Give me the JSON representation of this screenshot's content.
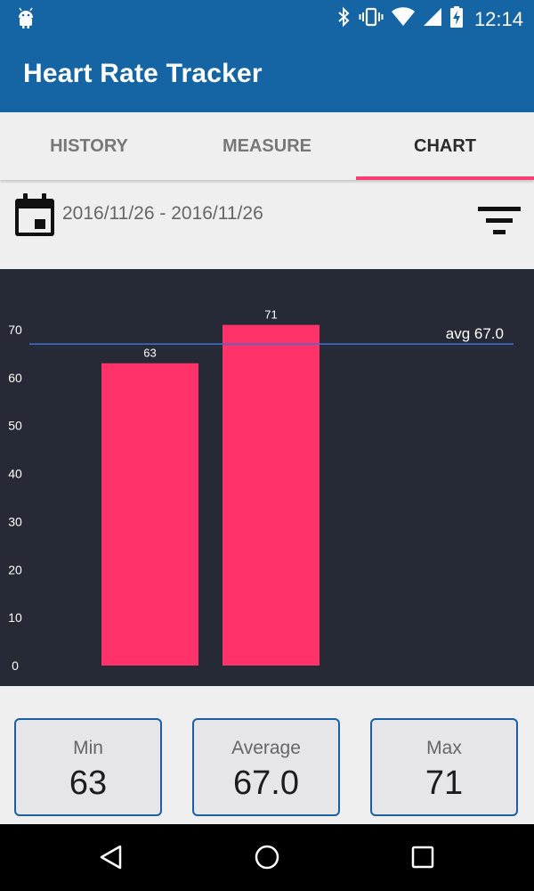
{
  "status_bar": {
    "time": "12:14",
    "icons": [
      "android-icon",
      "bluetooth-icon",
      "vibrate-icon",
      "wifi-icon",
      "signal-icon",
      "battery-charging-icon"
    ]
  },
  "app": {
    "title": "Heart Rate Tracker",
    "primary_color": "#1565a5",
    "accent_color": "#ff3d6f"
  },
  "tabs": [
    {
      "label": "HISTORY",
      "active": false
    },
    {
      "label": "MEASURE",
      "active": false
    },
    {
      "label": "CHART",
      "active": true
    }
  ],
  "filter": {
    "date_range": "2016/11/26 - 2016/11/26",
    "icons": [
      "calendar-icon",
      "filter-icon"
    ]
  },
  "chart_data": {
    "type": "bar",
    "categories": [
      "",
      ""
    ],
    "values": [
      63,
      71
    ],
    "value_labels": [
      "63",
      "71"
    ],
    "ylim": [
      0,
      70
    ],
    "yticks": [
      "0",
      "10",
      "20",
      "30",
      "40",
      "50",
      "60",
      "70"
    ],
    "average_line": {
      "value": 67.0,
      "label": "avg 67.0",
      "color": "#3d6fd8"
    },
    "bar_color": "#ff3369",
    "background": "#252a36",
    "grid": false
  },
  "stats": {
    "min": {
      "label": "Min",
      "value": "63"
    },
    "average": {
      "label": "Average",
      "value": "67.0"
    },
    "max": {
      "label": "Max",
      "value": "71"
    }
  },
  "nav_bar": {
    "icons": [
      "back-icon",
      "home-icon",
      "recents-icon"
    ]
  }
}
